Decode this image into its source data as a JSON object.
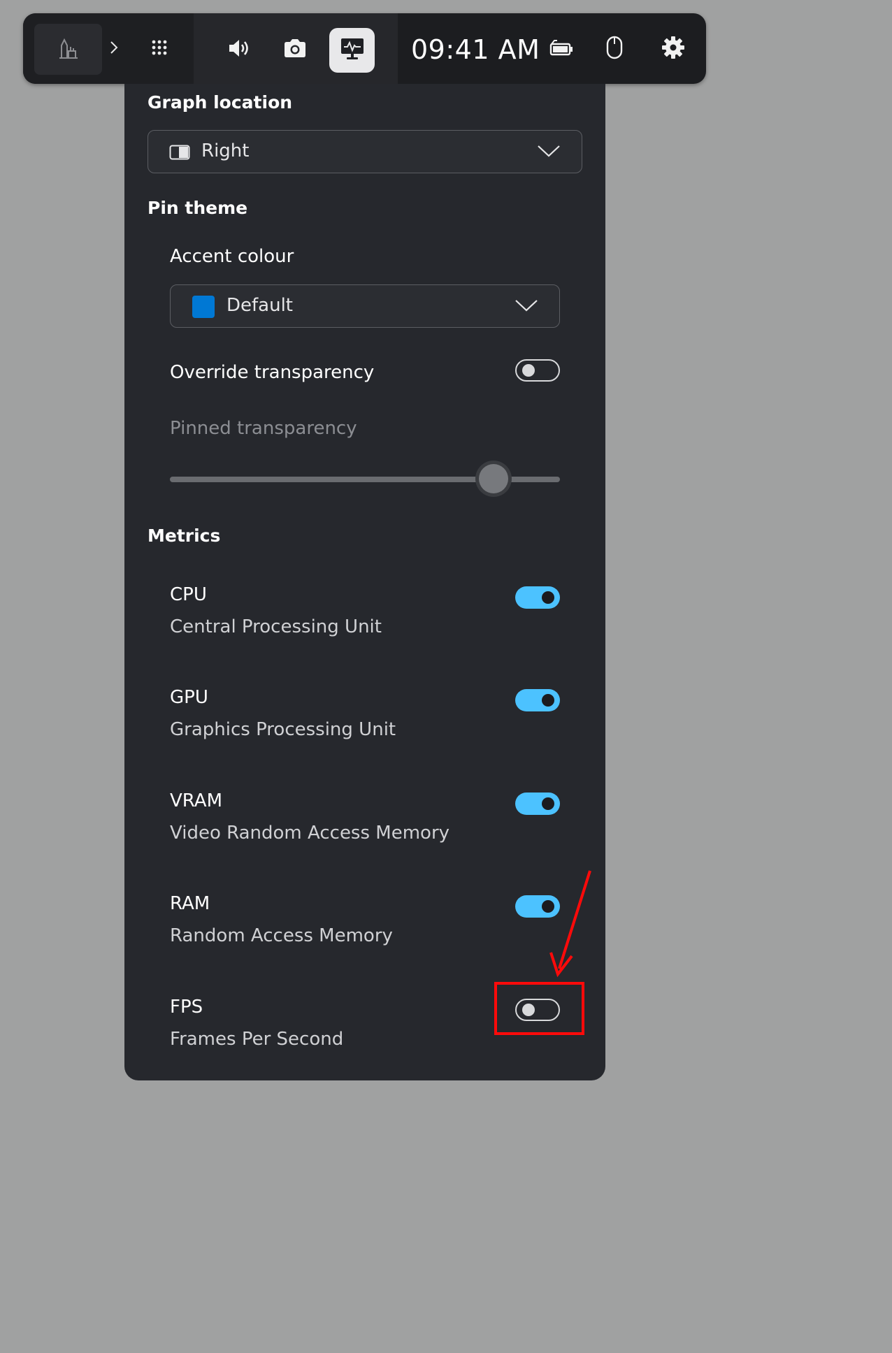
{
  "topbar": {
    "clock": "09:41 AM",
    "icons": {
      "app": "game-app-icon",
      "expand": "chevron-right-icon",
      "widgets": "grid-icon",
      "audio": "speaker-icon",
      "capture": "camera-icon",
      "performance": "performance-monitor-icon",
      "battery": "battery-icon",
      "mouse": "mouse-icon",
      "settings": "gear-icon"
    }
  },
  "panel": {
    "graph_location": {
      "title": "Graph location",
      "selected": "Right"
    },
    "pin_theme": {
      "title": "Pin theme",
      "accent_label": "Accent colour",
      "accent_selected": "Default",
      "accent_color": "#0078d4",
      "override_label": "Override transparency",
      "override_on": false,
      "pinned_label": "Pinned transparency",
      "pinned_value": 0.83
    },
    "metrics": {
      "title": "Metrics",
      "items": [
        {
          "name": "CPU",
          "desc": "Central Processing Unit",
          "on": true
        },
        {
          "name": "GPU",
          "desc": "Graphics Processing Unit",
          "on": true
        },
        {
          "name": "VRAM",
          "desc": "Video Random Access Memory",
          "on": true
        },
        {
          "name": "RAM",
          "desc": "Random Access Memory",
          "on": true
        },
        {
          "name": "FPS",
          "desc": "Frames Per Second",
          "on": false
        }
      ]
    }
  },
  "colors": {
    "toggle_on": "#4cc2ff",
    "annotation": "#ff0a0a"
  }
}
